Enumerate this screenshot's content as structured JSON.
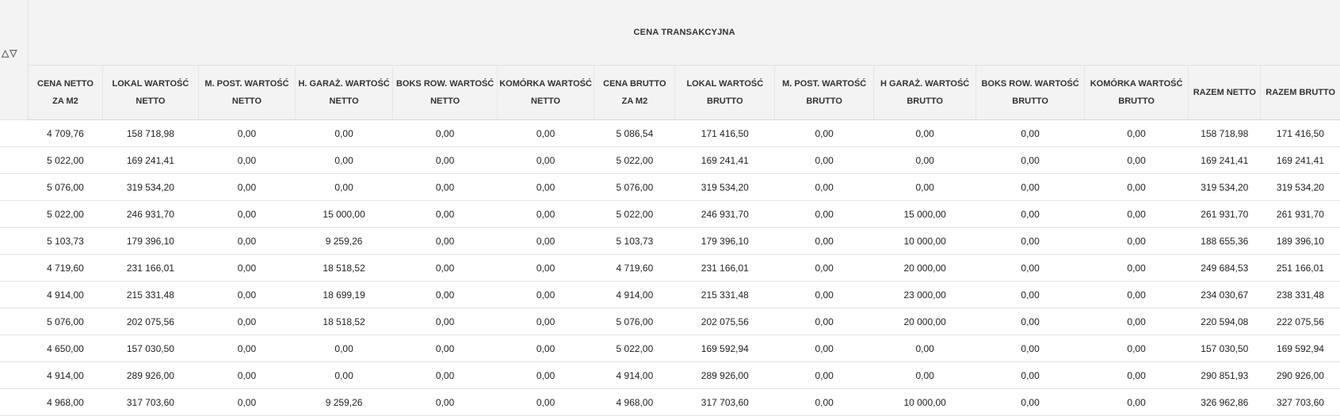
{
  "group_header": "CENA TRANSAKCYJNA",
  "sort_icons": "△▽",
  "columns": [
    "CENA NETTO ZA M2",
    "LOKAL WARTOŚĆ NETTO",
    "M. POST. WARTOŚĆ NETTO",
    "H. GARAŻ. WARTOŚĆ NETTO",
    "BOKS ROW. WARTOŚĆ NETTO",
    "KOMÓRKA WARTOŚĆ NETTO",
    "CENA BRUTTO ZA M2",
    "LOKAL WARTOŚĆ BRUTTO",
    "M. POST. WARTOŚĆ BRUTTO",
    "H GARAŻ. WARTOŚĆ BRUTTO",
    "BOKS ROW. WARTOŚĆ BRUTTO",
    "KOMÓRKA WARTOŚĆ BRUTTO",
    "RAZEM NETTO",
    "RAZEM BRUTTO"
  ],
  "rows": [
    [
      "4 709,76",
      "158 718,98",
      "0,00",
      "0,00",
      "0,00",
      "0,00",
      "5 086,54",
      "171 416,50",
      "0,00",
      "0,00",
      "0,00",
      "0,00",
      "158 718,98",
      "171 416,50"
    ],
    [
      "5 022,00",
      "169 241,41",
      "0,00",
      "0,00",
      "0,00",
      "0,00",
      "5 022,00",
      "169 241,41",
      "0,00",
      "0,00",
      "0,00",
      "0,00",
      "169 241,41",
      "169 241,41"
    ],
    [
      "5 076,00",
      "319 534,20",
      "0,00",
      "0,00",
      "0,00",
      "0,00",
      "5 076,00",
      "319 534,20",
      "0,00",
      "0,00",
      "0,00",
      "0,00",
      "319 534,20",
      "319 534,20"
    ],
    [
      "5 022,00",
      "246 931,70",
      "0,00",
      "15 000,00",
      "0,00",
      "0,00",
      "5 022,00",
      "246 931,70",
      "0,00",
      "15 000,00",
      "0,00",
      "0,00",
      "261 931,70",
      "261 931,70"
    ],
    [
      "5 103,73",
      "179 396,10",
      "0,00",
      "9 259,26",
      "0,00",
      "0,00",
      "5 103,73",
      "179 396,10",
      "0,00",
      "10 000,00",
      "0,00",
      "0,00",
      "188 655,36",
      "189 396,10"
    ],
    [
      "4 719,60",
      "231 166,01",
      "0,00",
      "18 518,52",
      "0,00",
      "0,00",
      "4 719,60",
      "231 166,01",
      "0,00",
      "20 000,00",
      "0,00",
      "0,00",
      "249 684,53",
      "251 166,01"
    ],
    [
      "4 914,00",
      "215 331,48",
      "0,00",
      "18 699,19",
      "0,00",
      "0,00",
      "4 914,00",
      "215 331,48",
      "0,00",
      "23 000,00",
      "0,00",
      "0,00",
      "234 030,67",
      "238 331,48"
    ],
    [
      "5 076,00",
      "202 075,56",
      "0,00",
      "18 518,52",
      "0,00",
      "0,00",
      "5 076,00",
      "202 075,56",
      "0,00",
      "20 000,00",
      "0,00",
      "0,00",
      "220 594,08",
      "222 075,56"
    ],
    [
      "4 650,00",
      "157 030,50",
      "0,00",
      "0,00",
      "0,00",
      "0,00",
      "5 022,00",
      "169 592,94",
      "0,00",
      "0,00",
      "0,00",
      "0,00",
      "157 030,50",
      "169 592,94"
    ],
    [
      "4 914,00",
      "289 926,00",
      "0,00",
      "0,00",
      "0,00",
      "0,00",
      "4 914,00",
      "289 926,00",
      "0,00",
      "0,00",
      "0,00",
      "0,00",
      "290 851,93",
      "290 926,00"
    ],
    [
      "4 968,00",
      "317 703,60",
      "0,00",
      "9 259,26",
      "0,00",
      "0,00",
      "4 968,00",
      "317 703,60",
      "0,00",
      "10 000,00",
      "0,00",
      "0,00",
      "326 962,86",
      "327 703,60"
    ]
  ]
}
